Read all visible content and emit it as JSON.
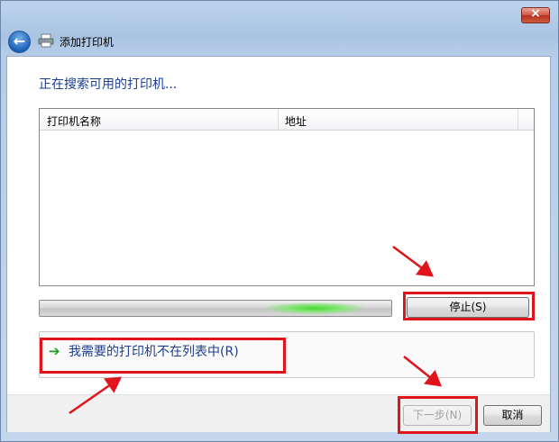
{
  "window": {
    "title": "添加打印机",
    "close_glyph": "×",
    "back_glyph": "←"
  },
  "main": {
    "heading": "正在搜索可用的打印机...",
    "list": {
      "columns": [
        "打印机名称",
        "地址"
      ],
      "rows": []
    },
    "progress": {
      "state": "indeterminate",
      "glow_color": "#45d92e"
    },
    "stop_button": "停止(S)",
    "not_listed_link": "我需要的打印机不在列表中(R)",
    "link_arrow_glyph": "➔"
  },
  "footer": {
    "next_button": "下一步(N)",
    "cancel_button": "取消"
  },
  "annotations": {
    "highlight_color": "#e0141a"
  },
  "icons": {
    "back": "back-arrow-icon",
    "printer": "printer-icon",
    "close": "close-icon",
    "link_arrow": "green-arrow-icon"
  }
}
